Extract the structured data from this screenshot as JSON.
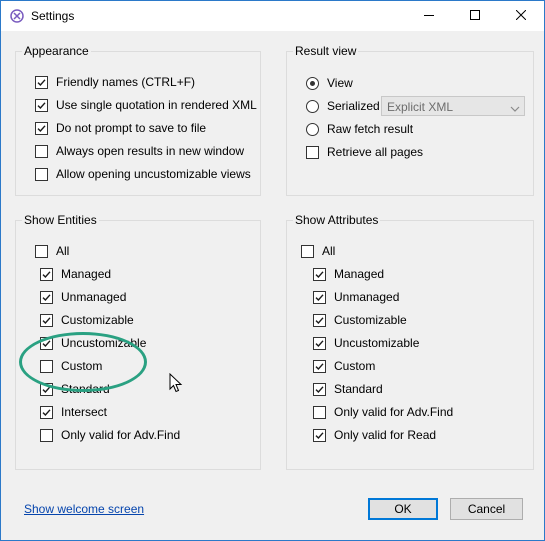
{
  "window": {
    "title": "Settings",
    "controls": [
      "minimize-icon",
      "maximize-icon",
      "close-icon"
    ]
  },
  "appearance": {
    "label": "Appearance",
    "options": [
      {
        "label": "Friendly names (CTRL+F)",
        "checked": true
      },
      {
        "label": "Use single quotation in rendered XML",
        "checked": true
      },
      {
        "label": "Do not prompt to save to file",
        "checked": true
      },
      {
        "label": "Always open results in new window",
        "checked": false
      },
      {
        "label": "Allow opening uncustomizable views",
        "checked": false
      }
    ]
  },
  "result_view": {
    "label": "Result view",
    "radios": [
      {
        "label": "View",
        "selected": true
      },
      {
        "label": "Serialized",
        "selected": false
      },
      {
        "label": "Raw fetch result",
        "selected": false
      }
    ],
    "serialized_format": "Explicit XML",
    "retrieve_all": {
      "label": "Retrieve all pages",
      "checked": false
    }
  },
  "show_entities": {
    "label": "Show Entities",
    "options": [
      {
        "label": "All",
        "checked": false
      },
      {
        "label": "Managed",
        "checked": true
      },
      {
        "label": "Unmanaged",
        "checked": true
      },
      {
        "label": "Customizable",
        "checked": true
      },
      {
        "label": "Uncustomizable",
        "checked": true
      },
      {
        "label": "Custom",
        "checked": false
      },
      {
        "label": "Standard",
        "checked": true
      },
      {
        "label": "Intersect",
        "checked": true
      },
      {
        "label": "Only valid for Adv.Find",
        "checked": false
      }
    ]
  },
  "show_attributes": {
    "label": "Show Attributes",
    "options": [
      {
        "label": "All",
        "checked": false
      },
      {
        "label": "Managed",
        "checked": true
      },
      {
        "label": "Unmanaged",
        "checked": true
      },
      {
        "label": "Customizable",
        "checked": true
      },
      {
        "label": "Uncustomizable",
        "checked": true
      },
      {
        "label": "Custom",
        "checked": true
      },
      {
        "label": "Standard",
        "checked": true
      },
      {
        "label": "Only valid for Adv.Find",
        "checked": false
      },
      {
        "label": "Only valid for Read",
        "checked": true
      }
    ]
  },
  "footer": {
    "welcome_link": "Show welcome screen",
    "ok_label": "OK",
    "cancel_label": "Cancel"
  },
  "colors": {
    "accent": "#0078d7",
    "annotation": "#2aa182"
  }
}
